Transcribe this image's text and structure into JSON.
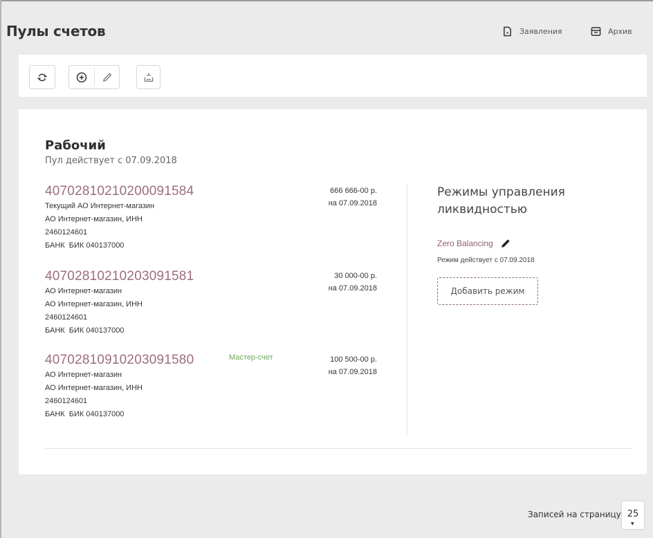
{
  "header": {
    "title": "Пулы счетов",
    "statements_label": "Заявления",
    "archive_label": "Архив"
  },
  "toolbar": {
    "buttons": [
      {
        "name": "refresh",
        "icon": "refresh-icon"
      },
      {
        "name": "add",
        "icon": "plus-circle-icon"
      },
      {
        "name": "edit",
        "icon": "pencil-icon"
      },
      {
        "name": "dissolve-pool",
        "icon": "pool-icon"
      }
    ]
  },
  "pool": {
    "name": "Рабочий",
    "since": "Пул действует с 07.09.2018",
    "accounts": [
      {
        "number": "40702810210200091584",
        "lines": [
          "Текущий АО Интернет-магазин",
          "АО Интернет-магазин, ИНН",
          "2460124601",
          "БАНК  БИК 040137000"
        ],
        "badge": "",
        "amount": "666 666-00 р.",
        "date": "на 07.09.2018"
      },
      {
        "number": "40702810210203091581",
        "lines": [
          "АО Интернет-магазин",
          "АО Интернет-магазин, ИНН",
          "2460124601",
          "БАНК  БИК 040137000"
        ],
        "badge": "",
        "amount": "30 000-00 р.",
        "date": "на 07.09.2018"
      },
      {
        "number": "40702810910203091580",
        "lines": [
          "АО Интернет-магазин",
          "АО Интернет-магазин, ИНН",
          "2460124601",
          "БАНК  БИК 040137000"
        ],
        "badge": "Мастер-счет",
        "amount": "100 500-00 р.",
        "date": "на 07.09.2018"
      }
    ]
  },
  "modes": {
    "title": "Режимы управления ликвидностью",
    "items": [
      {
        "name": "Zero Balancing",
        "since": "Режим действует с 07.09.2018"
      }
    ],
    "add_label": "Добавить режим"
  },
  "footer": {
    "per_page_label": "Записей на страницу",
    "per_page_value": "25"
  },
  "colors": {
    "account_number": "#9b6e7b",
    "master_badge": "#6ea85a",
    "accent_border": "#8d6a76",
    "background": "#ebebeb"
  }
}
